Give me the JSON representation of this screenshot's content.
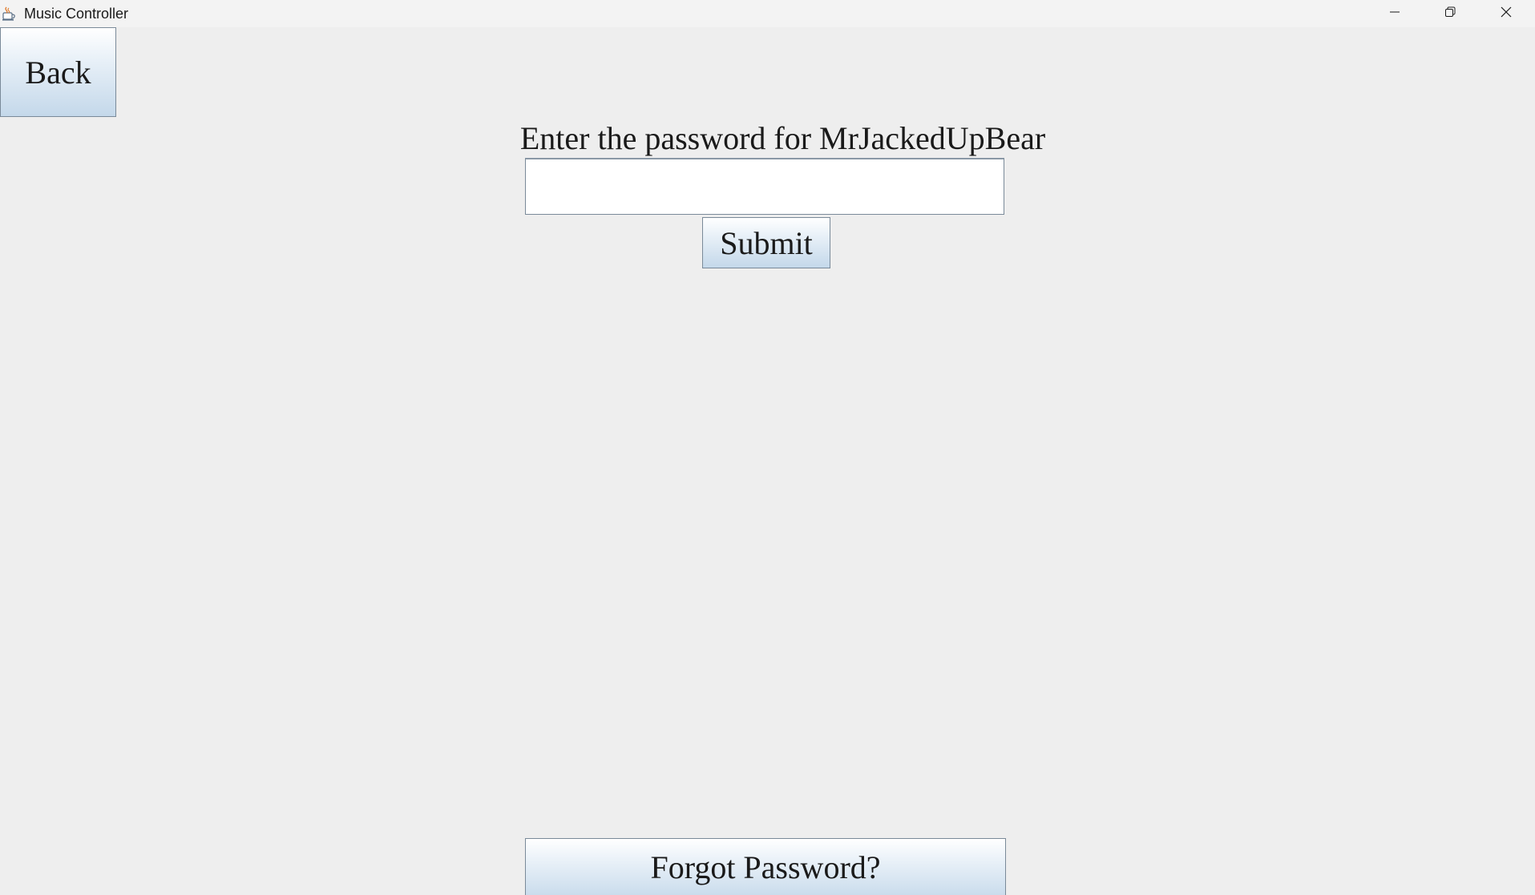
{
  "window": {
    "title": "Music Controller",
    "app_icon": "java-cup-icon",
    "controls": {
      "minimize_icon": "minimize-icon",
      "maximize_icon": "restore-icon",
      "close_icon": "close-icon"
    }
  },
  "navigation": {
    "back_label": "Back"
  },
  "login": {
    "prompt": "Enter the password for MrJackedUpBear",
    "password_value": "",
    "submit_label": "Submit",
    "forgot_label": "Forgot Password?"
  },
  "colors": {
    "background": "#eeeeee",
    "titlebar": "#f3f3f3",
    "button_border": "#7a8a99",
    "button_gradient_top": "#ffffff",
    "button_gradient_bottom": "#c4d8ea"
  }
}
